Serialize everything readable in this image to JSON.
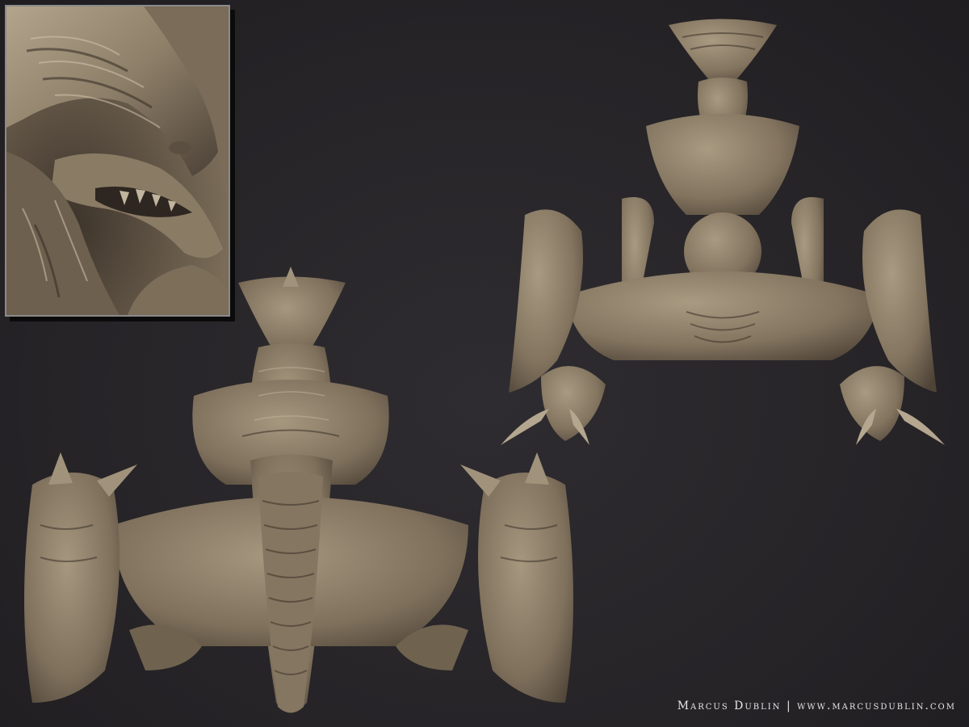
{
  "credit": {
    "text": "Marcus Dublin | www.marcusdublin.com"
  },
  "colors": {
    "background": "#282629",
    "clay": "#8b7c67",
    "clay_light": "#a89a83",
    "clay_dark": "#4a4034",
    "inset_border": "#8a8a8a",
    "text": "#e6e6e6"
  }
}
